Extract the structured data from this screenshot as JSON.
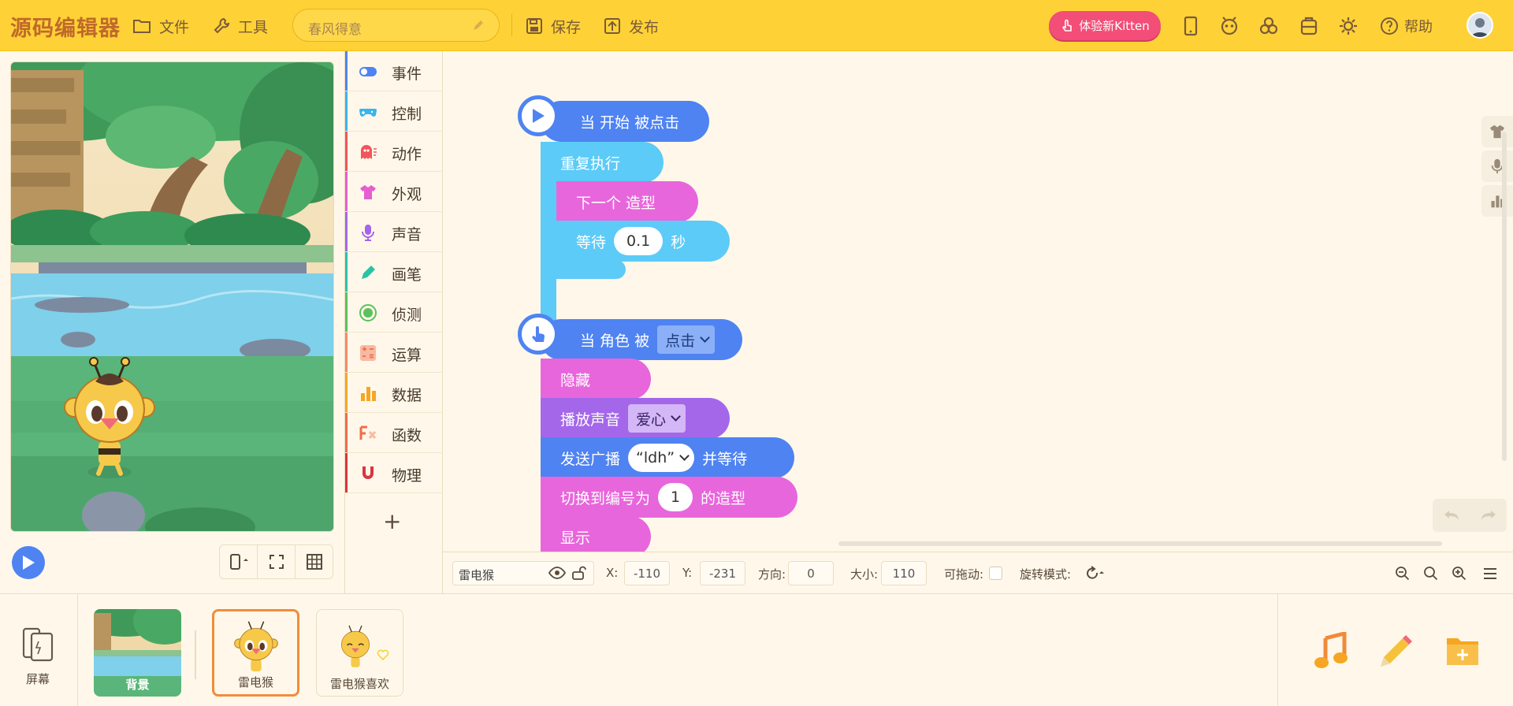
{
  "app": {
    "logo": "源码编辑器",
    "menu": {
      "file": "文件",
      "tools": "工具",
      "save": "保存",
      "publish": "发布",
      "help": "帮助"
    },
    "project_name": "春风得意",
    "kitten_button": "体验新Kitten"
  },
  "categories": [
    {
      "label": "事件",
      "color": "#4f83f2",
      "icon": "toggle-icon"
    },
    {
      "label": "控制",
      "color": "#39b4f0",
      "icon": "gamepad-icon"
    },
    {
      "label": "动作",
      "color": "#f2555a",
      "icon": "ghost-icon"
    },
    {
      "label": "外观",
      "color": "#e45fcf",
      "icon": "shirt-icon"
    },
    {
      "label": "声音",
      "color": "#a467ea",
      "icon": "microphone-icon"
    },
    {
      "label": "画笔",
      "color": "#29c3a7",
      "icon": "pen-icon"
    },
    {
      "label": "侦测",
      "color": "#5bc15a",
      "icon": "radar-icon"
    },
    {
      "label": "运算",
      "color": "#f68a6a",
      "icon": "calculator-icon"
    },
    {
      "label": "数据",
      "color": "#f6a623",
      "icon": "bar-chart-icon"
    },
    {
      "label": "函数",
      "color": "#f46a4a",
      "icon": "function-icon"
    },
    {
      "label": "物理",
      "color": "#d9363e",
      "icon": "magnet-icon"
    }
  ],
  "scripts": {
    "script1": {
      "hat": "当 开始 被点击",
      "repeat": "重复执行",
      "next_costume": "下一个 造型",
      "wait_prefix": "等待",
      "wait_value": "0.1",
      "wait_suffix": "秒"
    },
    "script2": {
      "hat_prefix": "当 角色 被",
      "hat_option": "点击",
      "hide": "隐藏",
      "play_sound": "播放声音",
      "sound_option": "爱心",
      "broadcast_prefix": "发送广播",
      "broadcast_option": "“ldh”",
      "broadcast_suffix": "并等待",
      "switch_prefix": "切换到编号为",
      "switch_value": "1",
      "switch_suffix": "的造型",
      "show": "显示"
    }
  },
  "sprite_info": {
    "name": "雷电猴",
    "x_label": "X:",
    "x": "-110",
    "y_label": "Y:",
    "y": "-231",
    "dir_label": "方向:",
    "dir": "0",
    "size_label": "大小:",
    "size": "110",
    "drag_label": "可拖动:",
    "rotate_label": "旋转模式:"
  },
  "sprites": {
    "screen_label": "屏幕",
    "items": [
      {
        "name": "背景"
      },
      {
        "name": "雷电猴"
      },
      {
        "name": "雷电猴喜欢"
      }
    ]
  },
  "colors": {
    "topbar": "#fed236",
    "event": "#4f83f2",
    "control": "#5ccbf7",
    "looks": "#e866db",
    "sound": "#a467ea",
    "kitten": "#f24e78"
  }
}
